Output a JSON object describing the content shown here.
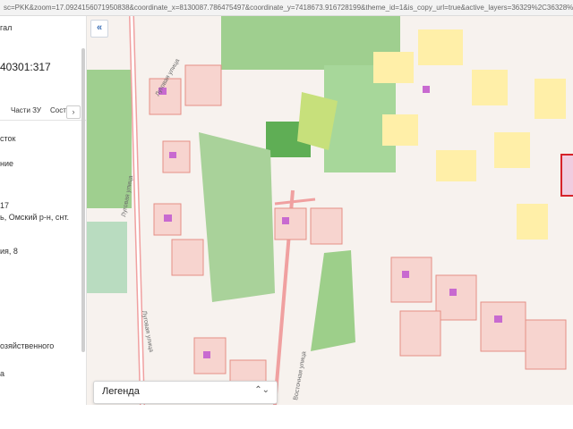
{
  "browser": {
    "url": "sc=PKK&zoom=17.0924156071950838&coordinate_x=8130087.786475497&coordinate_y=7418673.916728199&theme_id=1&is_copy_url=true&active_layers=36329%2C36328%2C36049%2C36048"
  },
  "panel": {
    "lines": [
      {
        "text": "гал"
      },
      {
        "text": "40301:317"
      },
      {
        "text": "сток"
      },
      {
        "text": "ние"
      },
      {
        "text": "17"
      },
      {
        "text": "ь, Омский р-н, снт."
      },
      {
        "text": "ия, 8"
      },
      {
        "text": "озяйственного"
      },
      {
        "text": "а"
      }
    ],
    "tabs": [
      {
        "label": "Части ЗУ"
      },
      {
        "label": "Сост"
      }
    ],
    "tab_arrow": "›"
  },
  "map": {
    "collapse_label": "«",
    "legend_label": "Легенда",
    "legend_chevron": "⌃⌄",
    "streets": [
      {
        "text": "Луговая улица"
      },
      {
        "text": "Луговая улица"
      },
      {
        "text": "Луговая улица"
      },
      {
        "text": "Восточная улица"
      }
    ]
  },
  "colors": {
    "parcel_fill": "#f7d4cf",
    "parcel_stroke": "#e58f86",
    "building": "#ffefa8",
    "forest": "#9fcf8f",
    "object": "#c86ad0",
    "selected": "#d6232a"
  }
}
